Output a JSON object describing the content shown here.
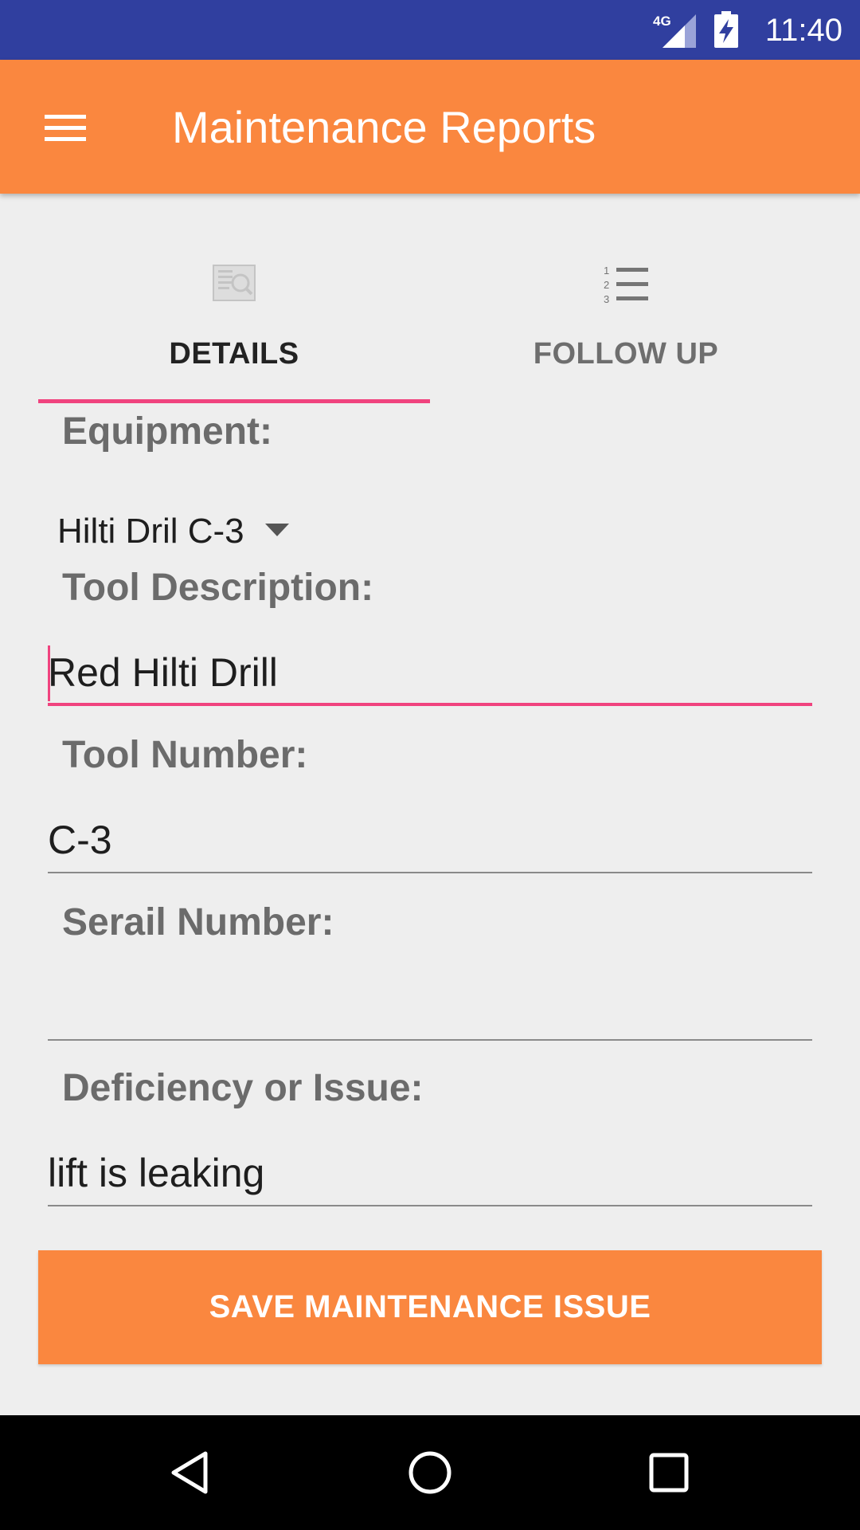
{
  "status_bar": {
    "network": "4G",
    "time": "11:40",
    "colors": {
      "background": "#303f9f"
    }
  },
  "app_bar": {
    "title": "Maintenance Reports",
    "menu_icon": "hamburger-menu-icon",
    "colors": {
      "background": "#fa873f"
    }
  },
  "tabs": [
    {
      "label": "DETAILS",
      "icon": "details-search-icon",
      "selected": true
    },
    {
      "label": "FOLLOW UP",
      "icon": "numbered-list-icon",
      "selected": false
    }
  ],
  "form": {
    "equipment": {
      "label": "Equipment:",
      "selected_value": "Hilti Dril C-3"
    },
    "tool_description": {
      "label": "Tool Description:",
      "value": "Red Hilti Drill",
      "focused": true
    },
    "tool_number": {
      "label": "Tool Number:",
      "value": "C-3"
    },
    "serial_number": {
      "label": "Serail Number:",
      "value": ""
    },
    "deficiency": {
      "label": "Deficiency or Issue:",
      "value": "lift is leaking"
    }
  },
  "save_button": {
    "label": "SAVE MAINTENANCE ISSUE"
  },
  "nav_bar": {
    "buttons": [
      "back-icon",
      "home-icon",
      "recent-apps-icon"
    ]
  },
  "colors": {
    "accent": "#f0437e",
    "primary": "#fa873f",
    "background": "#eeeeee"
  }
}
